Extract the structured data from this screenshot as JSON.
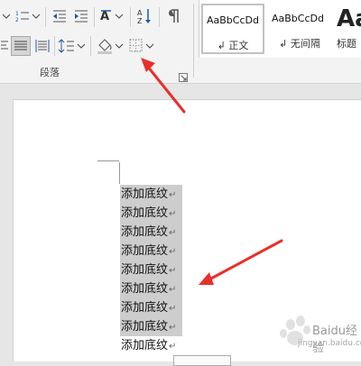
{
  "ribbon": {
    "paragraph_group_label": "段落",
    "styles": [
      {
        "preview": "AaBbCcDd",
        "name": "↲ 正文",
        "selected": true
      },
      {
        "preview": "AaBbCcDd",
        "name": "↲ 无间隔",
        "selected": false
      },
      {
        "preview": "Aa",
        "name": "标题",
        "selected": false
      }
    ]
  },
  "document": {
    "lines": [
      {
        "text": "添加底纹",
        "shaded": true
      },
      {
        "text": "添加底纹",
        "shaded": true
      },
      {
        "text": "添加底纹",
        "shaded": true
      },
      {
        "text": "添加底纹",
        "shaded": true
      },
      {
        "text": "添加底纹",
        "shaded": true
      },
      {
        "text": "添加底纹",
        "shaded": true
      },
      {
        "text": "添加底纹",
        "shaded": true
      },
      {
        "text": "添加底纹",
        "shaded": true
      },
      {
        "text": "添加底纹",
        "shaded": false
      }
    ],
    "pilcrow": "↵"
  },
  "colors": {
    "arrow": "#e8302a",
    "shading": "#cdcdcd"
  },
  "watermark": {
    "text": "Baidu经验",
    "subtext": "jingyan.baidu.com"
  }
}
